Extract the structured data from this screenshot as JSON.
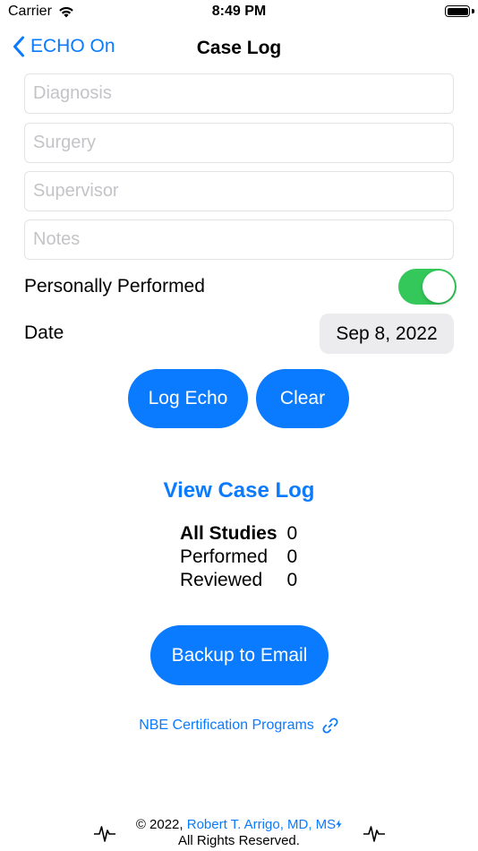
{
  "status_bar": {
    "carrier": "Carrier",
    "time": "8:49 PM"
  },
  "nav": {
    "back_label": "ECHO On",
    "title": "Case Log"
  },
  "form": {
    "diagnosis_placeholder": "Diagnosis",
    "diagnosis_value": "",
    "surgery_placeholder": "Surgery",
    "surgery_value": "",
    "supervisor_placeholder": "Supervisor",
    "supervisor_value": "",
    "notes_placeholder": "Notes",
    "notes_value": "",
    "personally_performed_label": "Personally Performed",
    "personally_performed": true,
    "date_label": "Date",
    "date_value": "Sep 8, 2022"
  },
  "actions": {
    "log_echo_label": "Log Echo",
    "clear_label": "Clear",
    "view_case_log_label": "View Case Log",
    "backup_label": "Backup to Email",
    "nbe_link_label": "NBE Certification Programs"
  },
  "stats": [
    {
      "label": "All Studies",
      "value": "0"
    },
    {
      "label": "Performed",
      "value": "0"
    },
    {
      "label": "Reviewed",
      "value": "0"
    }
  ],
  "footer": {
    "copyright": "© 2022,",
    "author": "Robert T. Arrigo, MD, MS",
    "rights": "All Rights Reserved."
  },
  "colors": {
    "accent": "#0a7aff",
    "toggle_on": "#34c759",
    "placeholder": "#c4c4c8",
    "field_border": "#e3e3e6",
    "date_pill_bg": "#ececee"
  },
  "icons": {
    "wifi": "wifi-icon",
    "battery": "battery-icon",
    "back": "chevron-left-icon",
    "link": "link-icon",
    "heartbeat": "heartbeat-icon",
    "bolt": "bolt-icon"
  }
}
